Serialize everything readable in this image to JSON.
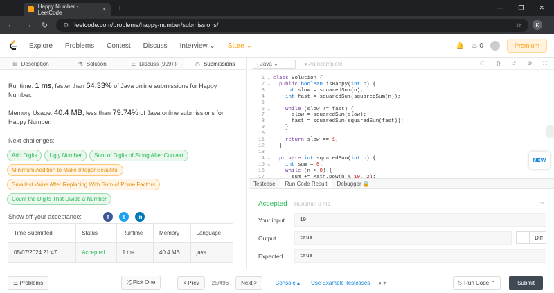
{
  "browser": {
    "tab_title": "Happy Number - LeetCode",
    "url": "leetcode.com/problems/happy-number/submissions/",
    "profile": "K"
  },
  "nav": {
    "items": [
      "Explore",
      "Problems",
      "Contest",
      "Discuss",
      "Interview"
    ],
    "store": "Store",
    "notif_count": "0",
    "premium": "Premium"
  },
  "left_tabs": [
    "Description",
    "Solution",
    "Discuss (999+)",
    "Submissions"
  ],
  "runtime": {
    "prefix": "Runtime: ",
    "value": "1 ms",
    "mid": ", faster than ",
    "pct": "64.33%",
    "suffix": " of Java online submissions for Happy Number."
  },
  "memory": {
    "prefix": "Memory Usage: ",
    "value": "40.4 MB",
    "mid": ", less than ",
    "pct": "79.74%",
    "suffix": " of Java online submissions for Happy Number."
  },
  "next_label": "Next challenges:",
  "challenges": [
    {
      "label": "Add Digits",
      "level": "easy"
    },
    {
      "label": "Ugly Number",
      "level": "easy"
    },
    {
      "label": "Sum of Digits of String After Convert",
      "level": "easy"
    },
    {
      "label": "Minimum Addition to Make Integer Beautiful",
      "level": "medium"
    },
    {
      "label": "Smallest Value After Replacing With Sum of Prime Factors",
      "level": "medium"
    },
    {
      "label": "Count the Digits That Divide a Number",
      "level": "easy"
    }
  ],
  "share_label": "Show off your acceptance:",
  "table": {
    "headers": [
      "Time Submitted",
      "Status",
      "Runtime",
      "Memory",
      "Language"
    ],
    "row": [
      "05/07/2024 21:47",
      "Accepted",
      "1 ms",
      "40.4 MB",
      "java"
    ]
  },
  "bottom": {
    "problems": "Problems",
    "pick_one": "Pick One",
    "prev": "< Prev",
    "page": "25/496",
    "next": "Next >",
    "console": "Console",
    "example": "Use Example Testcases",
    "run": "Run Code",
    "submit": "Submit"
  },
  "editor": {
    "lang": "Java",
    "autocomplete": "Autocomplete"
  },
  "code_lines": [
    "class Solution {",
    "  public boolean isHappy(int n) {",
    "    int slow = squaredSum(n);",
    "    int fast = squaredSum(squaredSum(n));",
    "",
    "    while (slow != fast) {",
    "      slow = squaredSum(slow);",
    "      fast = squaredSum(squaredSum(fast));",
    "    }",
    "",
    "    return slow == 1;",
    "  }",
    "",
    "  private int squaredSum(int n) {",
    "    int sum = 0;",
    "    while (n > 0) {",
    "      sum += Math.pow(n % 10, 2);"
  ],
  "new_badge": "NEW",
  "result_tabs": [
    "Testcase",
    "Run Code Result",
    "Debugger"
  ],
  "result": {
    "status": "Accepted",
    "runtime": "Runtime: 0 ms",
    "input_label": "Your input",
    "input": "19",
    "output_label": "Output",
    "output": "true",
    "diff": "Diff",
    "expected_label": "Expected",
    "expected": "true"
  }
}
